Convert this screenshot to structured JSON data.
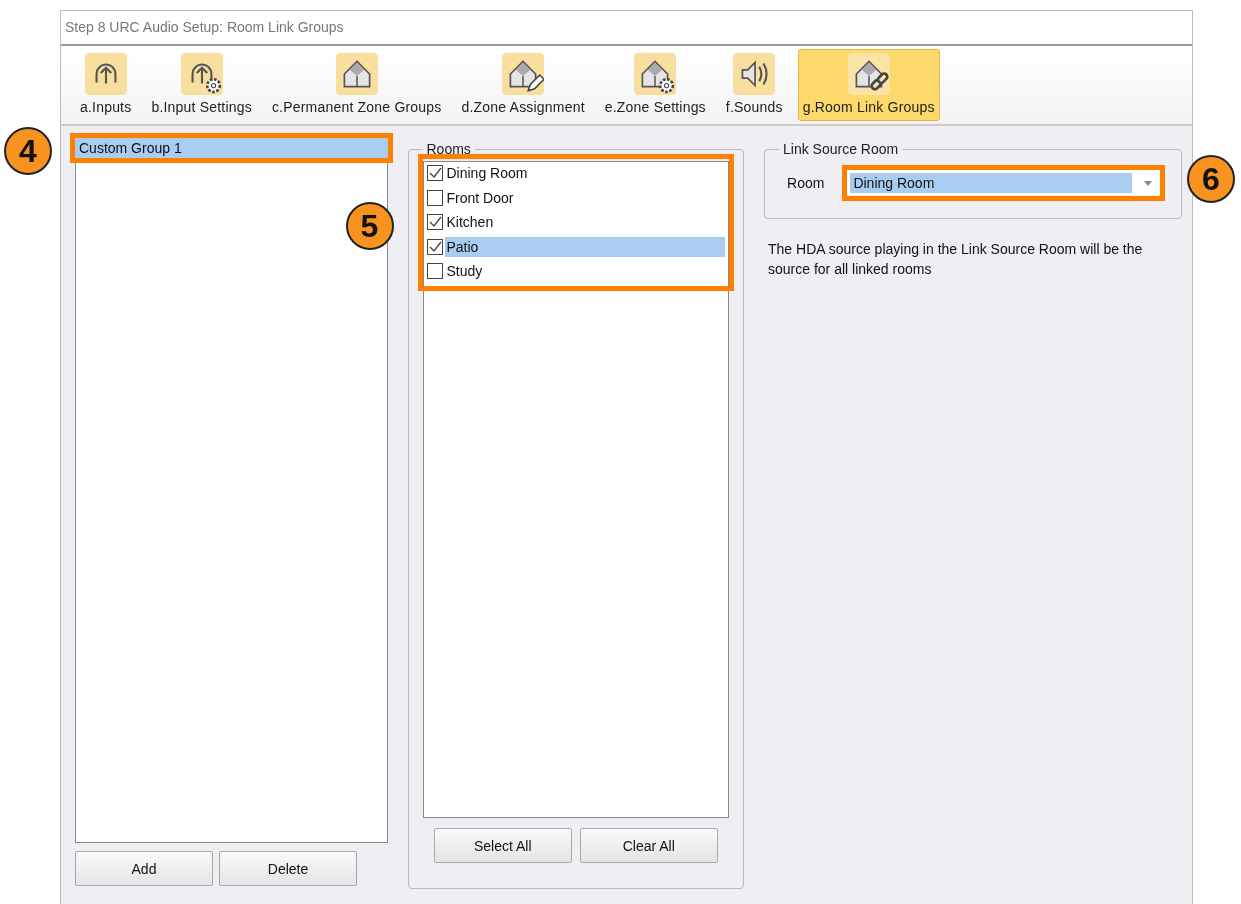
{
  "window": {
    "title": "Step 8 URC Audio Setup: Room Link Groups"
  },
  "tabs": [
    {
      "label": "a.Inputs",
      "kind": "arrow",
      "selected": false
    },
    {
      "label": "b.Input Settings",
      "kind": "arrow-gear",
      "selected": false
    },
    {
      "label": "c.Permanent Zone Groups",
      "kind": "house",
      "selected": false
    },
    {
      "label": "d.Zone Assignment",
      "kind": "house-pencil",
      "selected": false
    },
    {
      "label": "e.Zone Settings",
      "kind": "house-gear",
      "selected": false
    },
    {
      "label": "f.Sounds",
      "kind": "speaker",
      "selected": false
    },
    {
      "label": "g.Room Link Groups",
      "kind": "house-link",
      "selected": true
    }
  ],
  "groups": {
    "callout": "4",
    "items": [
      {
        "label": "Custom Group 1",
        "selected": true
      }
    ],
    "buttons": [
      "Add",
      "Delete"
    ]
  },
  "rooms": {
    "title": "Rooms",
    "callout": "5",
    "items": [
      {
        "label": "Dining Room",
        "checked": true,
        "selected": false
      },
      {
        "label": "Front Door",
        "checked": false,
        "selected": false
      },
      {
        "label": "Kitchen",
        "checked": true,
        "selected": false
      },
      {
        "label": "Patio",
        "checked": true,
        "selected": true
      },
      {
        "label": "Study",
        "checked": false,
        "selected": false
      }
    ],
    "buttons": [
      "Select All",
      "Clear All"
    ]
  },
  "link_source": {
    "title": "Link Source Room",
    "label": "Room",
    "value": "Dining Room",
    "callout": "6",
    "note": "The HDA source playing in the Link Source Room will be the source for all linked rooms"
  }
}
